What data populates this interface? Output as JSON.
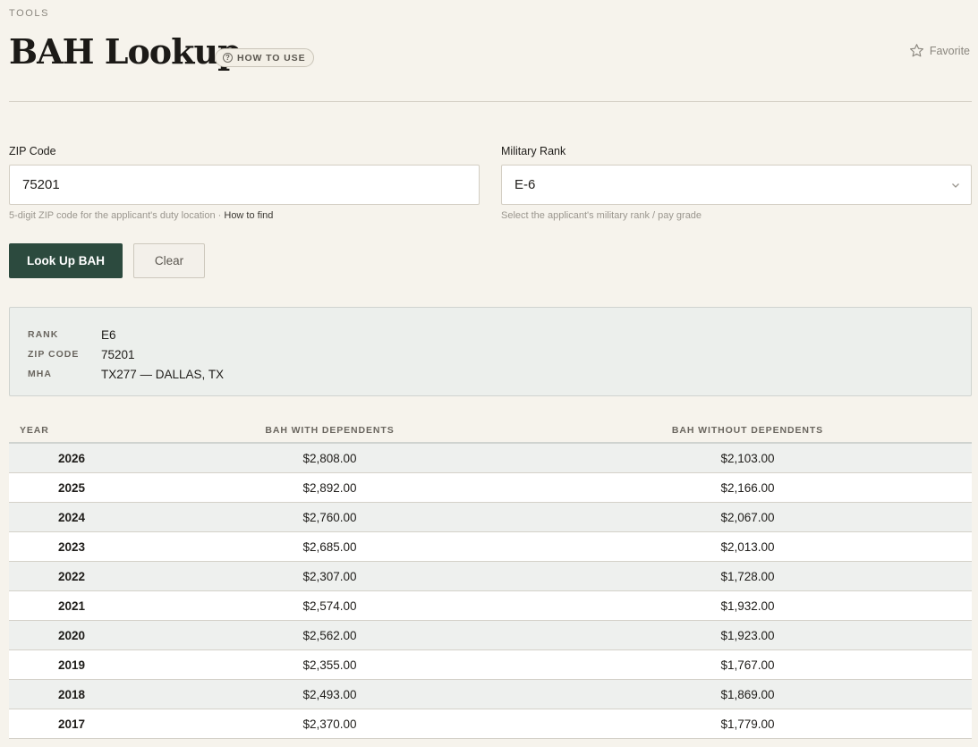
{
  "header": {
    "eyebrow": "TOOLS",
    "title": "BAH Lookup",
    "how_to_use": "HOW TO USE",
    "favorite": "Favorite"
  },
  "form": {
    "zip": {
      "label": "ZIP Code",
      "value": "75201",
      "hint": "5-digit ZIP code for the applicant's duty location · ",
      "hint_link": "How to find"
    },
    "rank": {
      "label": "Military Rank",
      "value": "E-6",
      "hint": "Select the applicant's military rank / pay grade"
    },
    "lookup_button": "Look Up BAH",
    "clear_button": "Clear"
  },
  "summary": {
    "rank_label": "RANK",
    "rank_value": "E6",
    "zip_label": "ZIP CODE",
    "zip_value": "75201",
    "mha_label": "MHA",
    "mha_value": "TX277 — DALLAS, TX"
  },
  "table": {
    "headers": [
      "YEAR",
      "BAH WITH DEPENDENTS",
      "BAH WITHOUT DEPENDENTS"
    ],
    "rows": [
      [
        "2026",
        "$2,808.00",
        "$2,103.00"
      ],
      [
        "2025",
        "$2,892.00",
        "$2,166.00"
      ],
      [
        "2024",
        "$2,760.00",
        "$2,067.00"
      ],
      [
        "2023",
        "$2,685.00",
        "$2,013.00"
      ],
      [
        "2022",
        "$2,307.00",
        "$1,728.00"
      ],
      [
        "2021",
        "$2,574.00",
        "$1,932.00"
      ],
      [
        "2020",
        "$2,562.00",
        "$1,923.00"
      ],
      [
        "2019",
        "$2,355.00",
        "$1,767.00"
      ],
      [
        "2018",
        "$2,493.00",
        "$1,869.00"
      ],
      [
        "2017",
        "$2,370.00",
        "$1,779.00"
      ]
    ]
  },
  "colors": {
    "background": "#f6f3ec",
    "primary_button": "#2c4a3e",
    "summary_bg": "#ecefec"
  }
}
